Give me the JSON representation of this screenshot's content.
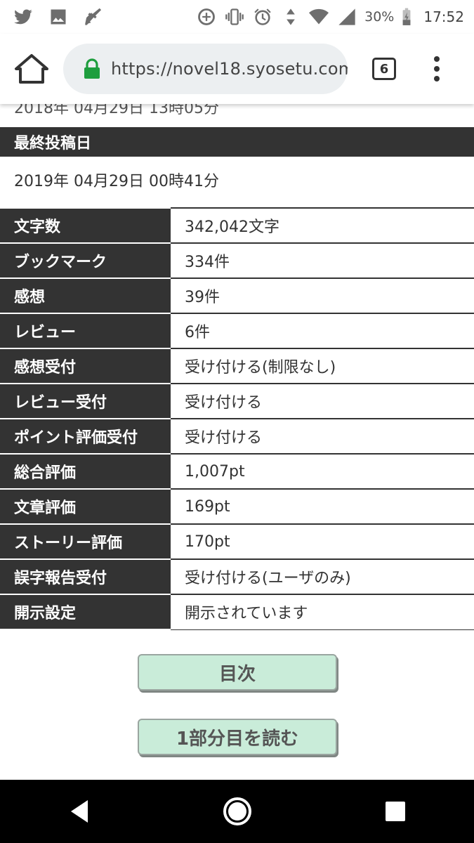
{
  "status_bar": {
    "left_icons": [
      "twitter-icon",
      "image-icon",
      "broom-icon"
    ],
    "right_icons": [
      "data-saver-icon",
      "vibrate-icon",
      "alarm-icon",
      "data-arrows-icon",
      "wifi-icon",
      "signal-icon",
      "battery-icon"
    ],
    "battery": "30%",
    "time": "17:52"
  },
  "browser": {
    "url": "https://novel18.syosetu.com",
    "tab_count": "6"
  },
  "page": {
    "cut_off_text": "2018年 04月29日 13時05分",
    "last_posted_label": "最終投稿日",
    "last_posted_value": "2019年  04月29日  00時41分",
    "rows": [
      {
        "label": "文字数",
        "value": "342,042文字"
      },
      {
        "label": "ブックマーク",
        "value": "334件"
      },
      {
        "label": "感想",
        "value": "39件"
      },
      {
        "label": "レビュー",
        "value": "6件"
      },
      {
        "label": "感想受付",
        "value": "受け付ける(制限なし)"
      },
      {
        "label": "レビュー受付",
        "value": "受け付ける"
      },
      {
        "label": "ポイント評価受付",
        "value": "受け付ける"
      },
      {
        "label": "総合評価",
        "value": "1,007pt"
      },
      {
        "label": "文章評価",
        "value": "169pt"
      },
      {
        "label": "ストーリー評価",
        "value": "170pt"
      },
      {
        "label": "誤字報告受付",
        "value": "受け付ける(ユーザのみ)"
      },
      {
        "label": "開示設定",
        "value": "開示されています"
      }
    ],
    "toc_button": "目次",
    "read_button": "1部分目を読む"
  },
  "colors": {
    "header_bg": "#333333",
    "button_bg": "#c9ecd9",
    "lock_green": "#1e9e3e"
  }
}
